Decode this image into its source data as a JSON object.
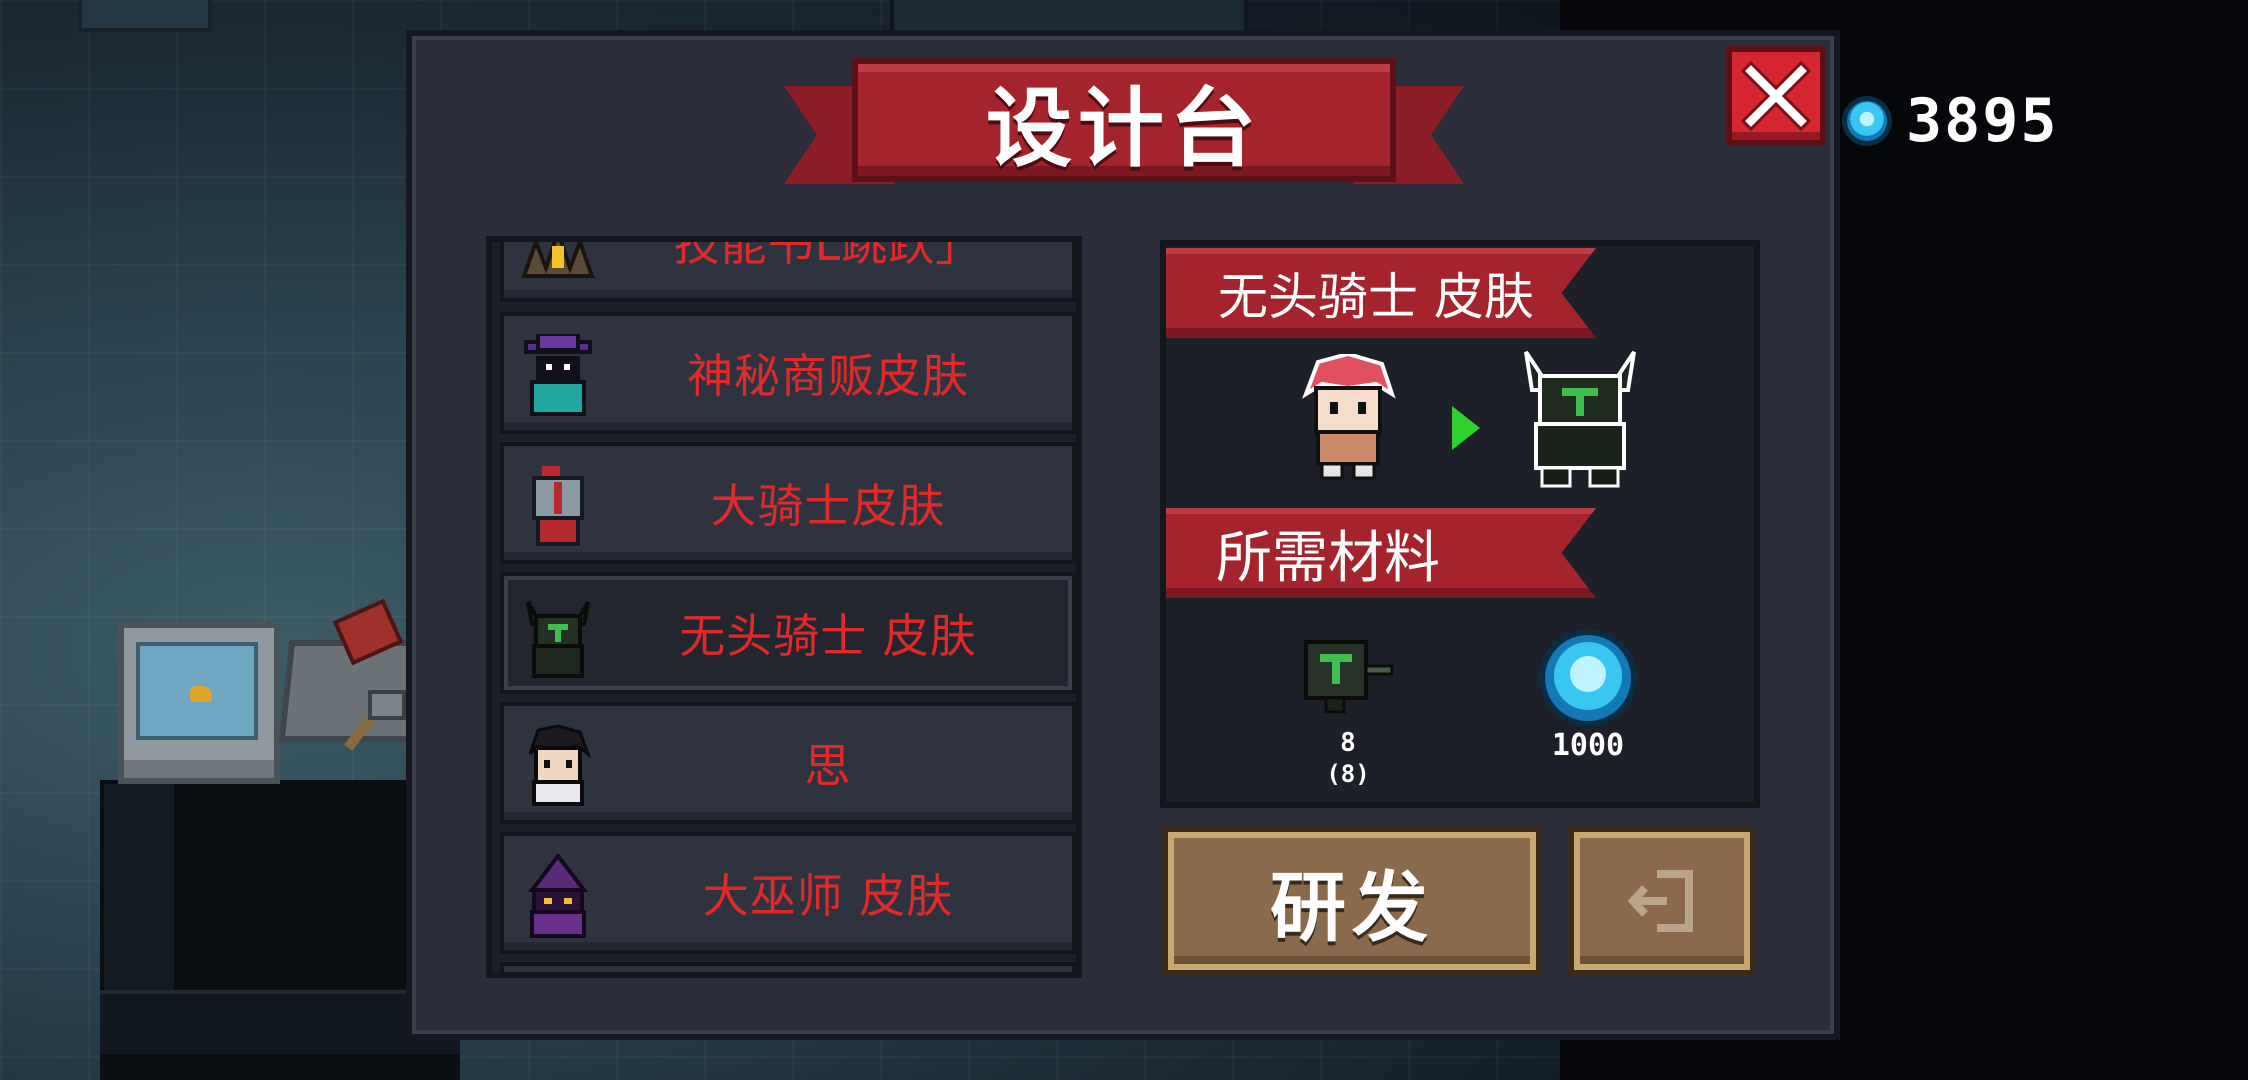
{
  "dialog": {
    "title": "设计台"
  },
  "currency": {
    "icon": "blue-gem-coin-icon",
    "value": "3895"
  },
  "list": {
    "items": [
      {
        "label": "技能书L跳跃」",
        "icon": "skill-book-icon",
        "checked": true,
        "partial": true
      },
      {
        "label": "神秘商贩皮肤",
        "icon": "mysterious-merchant-icon"
      },
      {
        "label": "大骑士皮肤",
        "icon": "grand-knight-icon"
      },
      {
        "label": "无头骑士  皮肤",
        "icon": "headless-knight-icon",
        "selected": true
      },
      {
        "label": "思",
        "icon": "si-character-icon"
      },
      {
        "label": "大巫师  皮肤",
        "icon": "archmage-icon"
      }
    ]
  },
  "detail": {
    "skin_title": "无头骑士  皮肤",
    "materials_title": "所需材料",
    "materials": [
      {
        "icon": "headless-knight-material-icon",
        "count": "8",
        "owned": "(8)"
      },
      {
        "icon": "blue-gem-coin-icon",
        "count": "1000"
      }
    ]
  },
  "buttons": {
    "research_label": "研发",
    "exit_icon": "exit-door-icon",
    "close_icon": "close-icon"
  },
  "colors": {
    "ribbon_red": "#a5232d",
    "item_text_red": "#e02a2a",
    "panel_bg": "#2b2e3a",
    "button_brown": "#8a6a4a",
    "arrow_green": "#2fd12f"
  }
}
